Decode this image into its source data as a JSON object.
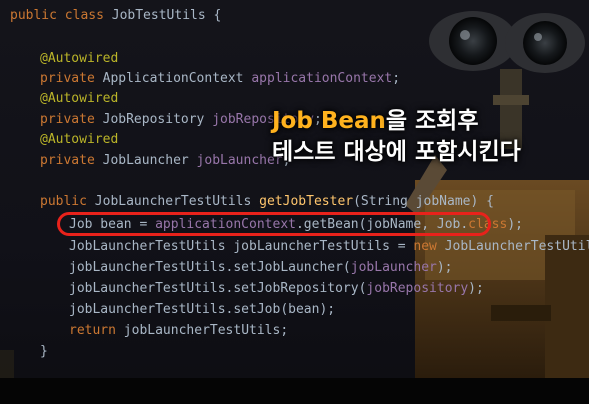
{
  "code": {
    "line1": {
      "kw": "public class ",
      "name": "JobTestUtils",
      "rest": " {"
    },
    "line2": {
      "ann": "@Autowired"
    },
    "line3": {
      "kw": "private ",
      "type": "ApplicationContext ",
      "field": "applicationContext",
      "end": ";"
    },
    "line4": {
      "ann": "@Autowired"
    },
    "line5": {
      "kw": "private ",
      "type": "JobRepository ",
      "field": "jobRepository",
      "end": ";"
    },
    "line6": {
      "ann": "@Autowired"
    },
    "line7": {
      "kw": "private ",
      "type": "JobLauncher ",
      "field": "jobLauncher",
      "end": ";"
    },
    "line8": {
      "kw": "public ",
      "type": "JobLauncherTestUtils ",
      "method": "getJobTester",
      "args": "(String jobName) {"
    },
    "line9": {
      "a": "Job bean = ",
      "field": "applicationContext",
      "b": ".getBean(jobName, Job.",
      "kw": "class",
      "c": ");"
    },
    "line10": {
      "a": "JobLauncherTestUtils jobLauncherTestUtils = ",
      "kw": "new ",
      "b": "JobLauncherTestUtils();"
    },
    "line11": {
      "a": "jobLauncherTestUtils.setJobLauncher(",
      "field": "jobLauncher",
      "b": ");"
    },
    "line12": {
      "a": "jobLauncherTestUtils.setJobRepository(",
      "field": "jobRepository",
      "b": ");"
    },
    "line13": {
      "a": "jobLauncherTestUtils.setJob(bean);"
    },
    "line14": {
      "kw": "return ",
      "a": "jobLauncherTestUtils;"
    },
    "line15": {
      "a": "}"
    }
  },
  "caption": {
    "line1_highlight": "Job Bean",
    "line1_rest": "을 조회후",
    "line2": "테스트 대상에 포함시킨다"
  },
  "colors": {
    "keyword": "#cc7832",
    "annotation": "#bbb529",
    "field": "#9876aa",
    "method": "#ffc66d",
    "highlight_box": "#e8221b",
    "caption_accent": "#ffb21e"
  },
  "decor": {
    "illustration": "robot-illustration"
  }
}
